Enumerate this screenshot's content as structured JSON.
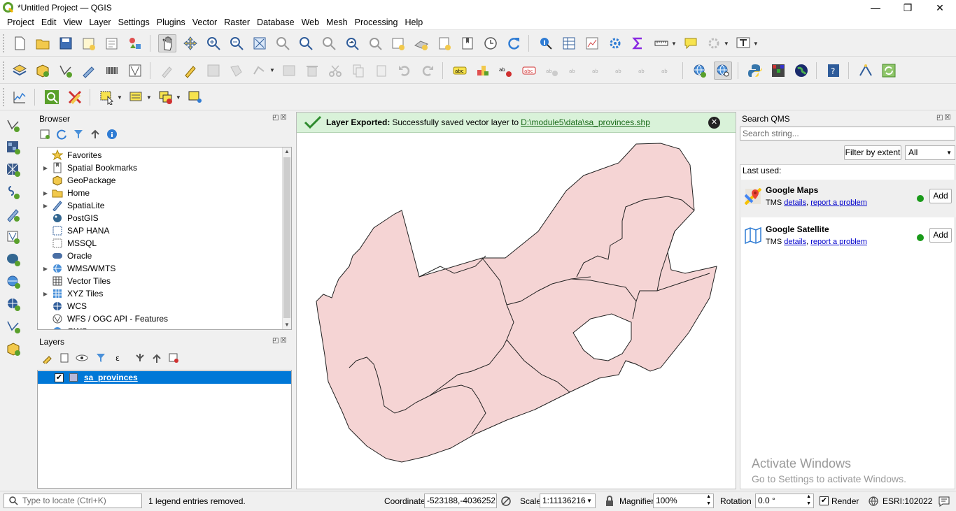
{
  "window": {
    "title": "*Untitled Project — QGIS",
    "controls": {
      "minimize": "—",
      "restore": "❐",
      "close": "✕"
    }
  },
  "menu": [
    "Project",
    "Edit",
    "View",
    "Layer",
    "Settings",
    "Plugins",
    "Vector",
    "Raster",
    "Database",
    "Web",
    "Mesh",
    "Processing",
    "Help"
  ],
  "browser": {
    "title": "Browser",
    "dock_buttons": "◰☒",
    "items": [
      {
        "label": "Favorites",
        "icon": "star-icon",
        "expandable": false
      },
      {
        "label": "Spatial Bookmarks",
        "icon": "bookmark-icon",
        "expandable": true
      },
      {
        "label": "GeoPackage",
        "icon": "geopackage-icon",
        "expandable": false
      },
      {
        "label": "Home",
        "icon": "folder-icon",
        "expandable": true
      },
      {
        "label": "SpatiaLite",
        "icon": "spatialite-icon",
        "expandable": true
      },
      {
        "label": "PostGIS",
        "icon": "postgis-icon",
        "expandable": false
      },
      {
        "label": "SAP HANA",
        "icon": "sap-hana-icon",
        "expandable": false
      },
      {
        "label": "MSSQL",
        "icon": "mssql-icon",
        "expandable": false
      },
      {
        "label": "Oracle",
        "icon": "oracle-icon",
        "expandable": false
      },
      {
        "label": "WMS/WMTS",
        "icon": "globe-icon",
        "expandable": true
      },
      {
        "label": "Vector Tiles",
        "icon": "vector-tiles-icon",
        "expandable": false
      },
      {
        "label": "XYZ Tiles",
        "icon": "xyz-tiles-icon",
        "expandable": true
      },
      {
        "label": "WCS",
        "icon": "wcs-icon",
        "expandable": false
      },
      {
        "label": "WFS / OGC API - Features",
        "icon": "wfs-icon",
        "expandable": false
      },
      {
        "label": "OWS",
        "icon": "ows-icon",
        "expandable": true
      }
    ]
  },
  "layers": {
    "title": "Layers",
    "dock_buttons": "◰☒",
    "items": [
      {
        "name": "sa_provinces",
        "checked": true
      }
    ]
  },
  "message_bar": {
    "bold": "Layer Exported:",
    "text": "Successfully saved vector layer to",
    "link": "D:\\module5\\data\\sa_provinces.shp",
    "close": "✕"
  },
  "map": {
    "fill_color": "#f5d4d4",
    "stroke_color": "#222222"
  },
  "qms": {
    "title": "Search QMS",
    "dock_buttons": "◰☒",
    "search_placeholder": "Search string...",
    "filter_button": "Filter by extent",
    "filter_value": "All",
    "last_used_label": "Last used:",
    "services": [
      {
        "name": "Google Maps",
        "type": "TMS",
        "details": "details",
        "report": "report a problem",
        "add": "Add",
        "icon": "google-maps-icon"
      },
      {
        "name": "Google Satellite",
        "type": "TMS",
        "details": "details",
        "report": "report a problem",
        "add": "Add",
        "icon": "map-icon"
      }
    ],
    "watermark_title": "Activate Windows",
    "watermark_sub": "Go to Settings to activate Windows."
  },
  "status": {
    "locate_placeholder": "Type to locate (Ctrl+K)",
    "message": "1 legend entries removed.",
    "coordinate_label": "Coordinate",
    "coordinate_value": "-523188,-4036252",
    "scale_label": "Scale",
    "scale_value": "1:11136216",
    "magnifier_label": "Magnifier",
    "magnifier_value": "100%",
    "rotation_label": "Rotation",
    "rotation_value": "0.0 °",
    "render_label": "Render",
    "render_checked": true,
    "crs": "ESRI:102022"
  }
}
